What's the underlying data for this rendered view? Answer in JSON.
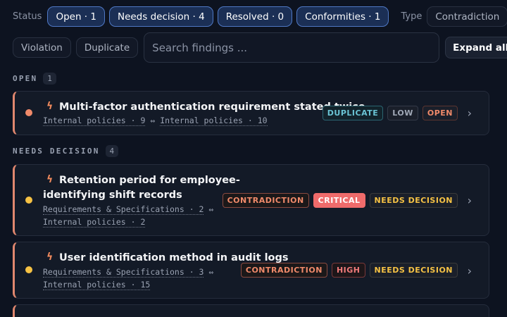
{
  "filters": {
    "status_label": "Status",
    "status": [
      {
        "label": "Open · 1"
      },
      {
        "label": "Needs decision · 4"
      },
      {
        "label": "Resolved · 0"
      },
      {
        "label": "Conformities · 1"
      }
    ],
    "type_label": "Type",
    "types": [
      {
        "label": "Contradiction"
      },
      {
        "label": "Violation"
      },
      {
        "label": "Duplicate"
      }
    ]
  },
  "search": {
    "placeholder": "Search findings ..."
  },
  "expand_label": "Expand all",
  "sections": [
    {
      "title": "OPEN",
      "count": "1",
      "cards": [
        {
          "title": "Multi-factor authentication requirement stated twice",
          "source_a": "Internal policies · 9",
          "link": "⇔",
          "source_b": "Internal policies · 10",
          "tags": [
            "DUPLICATE",
            "LOW",
            "OPEN"
          ]
        }
      ]
    },
    {
      "title": "NEEDS DECISION",
      "count": "4",
      "cards": [
        {
          "title_line1": "Retention period for employee-",
          "title_line2": "identifying shift records",
          "source_a": "Requirements & Specifications · 2",
          "link": "⇔",
          "source_b": "Internal policies · 2",
          "tags": [
            "CONTRADICTION",
            "CRITICAL",
            "NEEDS DECISION"
          ]
        },
        {
          "title": "User identification method in audit logs",
          "source_a": "Requirements & Specifications · 3",
          "link": "⇔",
          "source_b": "Internal policies · 15",
          "tags": [
            "CONTRADICTION",
            "HIGH",
            "NEEDS DECISION"
          ]
        }
      ]
    }
  ],
  "colors": {
    "open_dot": "#f08a6a",
    "decision_dot": "#f6c244",
    "accent_border": "#e0876e"
  }
}
